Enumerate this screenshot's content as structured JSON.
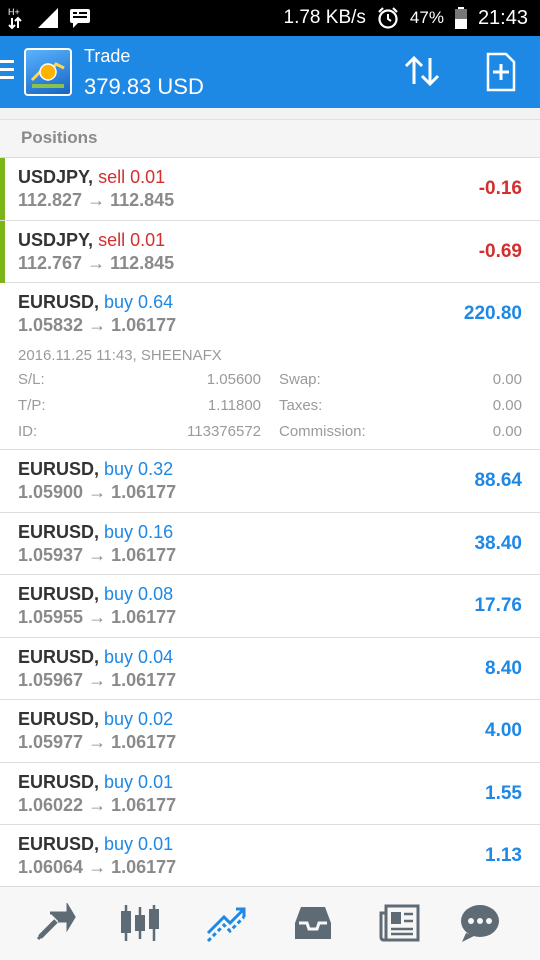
{
  "status_bar": {
    "net_label": "H+",
    "speed": "1.78 KB/s",
    "battery": "47%",
    "time": "21:43",
    "icons": [
      "data-arrows-icon",
      "signal-icon",
      "message-icon",
      "alarm-icon",
      "battery-icon"
    ]
  },
  "app_bar": {
    "title": "Trade",
    "balance": "379.83 USD",
    "icons": [
      "menu-icon",
      "app-logo",
      "sort-icon",
      "new-order-icon"
    ]
  },
  "section_title": "Positions",
  "positions": [
    {
      "symbol": "USDJPY,",
      "action": "sell 0.01",
      "direction": "sell",
      "open": "112.827",
      "arrow": "→",
      "current": "112.845",
      "profit": "-0.16"
    },
    {
      "symbol": "USDJPY,",
      "action": "sell 0.01",
      "direction": "sell",
      "open": "112.767",
      "arrow": "→",
      "current": "112.845",
      "profit": "-0.69"
    },
    {
      "symbol": "EURUSD,",
      "action": "buy 0.64",
      "direction": "buy",
      "open": "1.05832",
      "arrow": "→",
      "current": "1.06177",
      "profit": "220.80",
      "details": {
        "meta": "2016.11.25 11:43, SHEENAFX",
        "sl_label": "S/L:",
        "sl_value": "1.05600",
        "tp_label": "T/P:",
        "tp_value": "1.11800",
        "id_label": "ID:",
        "id_value": "113376572",
        "swap_label": "Swap:",
        "swap_value": "0.00",
        "taxes_label": "Taxes:",
        "taxes_value": "0.00",
        "commission_label": "Commission:",
        "commission_value": "0.00"
      }
    },
    {
      "symbol": "EURUSD,",
      "action": "buy 0.32",
      "direction": "buy",
      "open": "1.05900",
      "arrow": "→",
      "current": "1.06177",
      "profit": "88.64"
    },
    {
      "symbol": "EURUSD,",
      "action": "buy 0.16",
      "direction": "buy",
      "open": "1.05937",
      "arrow": "→",
      "current": "1.06177",
      "profit": "38.40"
    },
    {
      "symbol": "EURUSD,",
      "action": "buy 0.08",
      "direction": "buy",
      "open": "1.05955",
      "arrow": "→",
      "current": "1.06177",
      "profit": "17.76"
    },
    {
      "symbol": "EURUSD,",
      "action": "buy 0.04",
      "direction": "buy",
      "open": "1.05967",
      "arrow": "→",
      "current": "1.06177",
      "profit": "8.40"
    },
    {
      "symbol": "EURUSD,",
      "action": "buy 0.02",
      "direction": "buy",
      "open": "1.05977",
      "arrow": "→",
      "current": "1.06177",
      "profit": "4.00"
    },
    {
      "symbol": "EURUSD,",
      "action": "buy 0.01",
      "direction": "buy",
      "open": "1.06022",
      "arrow": "→",
      "current": "1.06177",
      "profit": "1.55"
    },
    {
      "symbol": "EURUSD,",
      "action": "buy 0.01",
      "direction": "buy",
      "open": "1.06064",
      "arrow": "→",
      "current": "1.06177",
      "profit": "1.13"
    }
  ],
  "bottom_nav": {
    "active": "trade",
    "items": [
      "quotes-icon",
      "chart-icon",
      "trade-icon",
      "history-icon",
      "news-icon",
      "chat-icon"
    ]
  },
  "colors": {
    "accent": "#1e88e5",
    "sell": "#d32f2f",
    "buy": "#1e88e5",
    "sell_marker": "#7cb518",
    "nav_icon": "#5f6b74",
    "nav_active": "#1e88e5"
  }
}
